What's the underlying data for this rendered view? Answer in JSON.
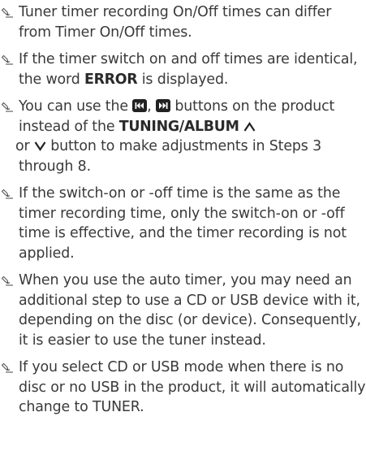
{
  "icons": {
    "note": "pencil-note-icon",
    "skip_back": "skip-back-button-icon",
    "skip_forward": "skip-forward-button-icon",
    "up": "up-arrow-icon",
    "down": "down-arrow-icon"
  },
  "notes": [
    {
      "text": "Tuner timer recording On/Off times can differ from Timer On/Off times."
    },
    {
      "before": "If the timer switch on and off times are identical, the word ",
      "keyword": "ERROR",
      "after": " is displayed."
    },
    {
      "before": "You can use the ",
      "sep": ", ",
      "middle": " buttons on the product instead of the ",
      "keyword": "TUNING/ALBUM",
      "or": " or ",
      "after": " button to make adjustments in Steps 3 through 8."
    },
    {
      "text": "If the switch-on or -off time is the same as the timer recording time, only the switch-on or -off time is effective, and the timer recording is not applied."
    },
    {
      "text": "When you use the auto timer, you may need an additional step to use a CD or USB device with it, depending on the disc (or device). Consequently, it is easier to use the tuner instead."
    },
    {
      "text": "If you select CD or USB mode when there is no disc or no USB in the product, it will automatically change to TUNER."
    }
  ]
}
